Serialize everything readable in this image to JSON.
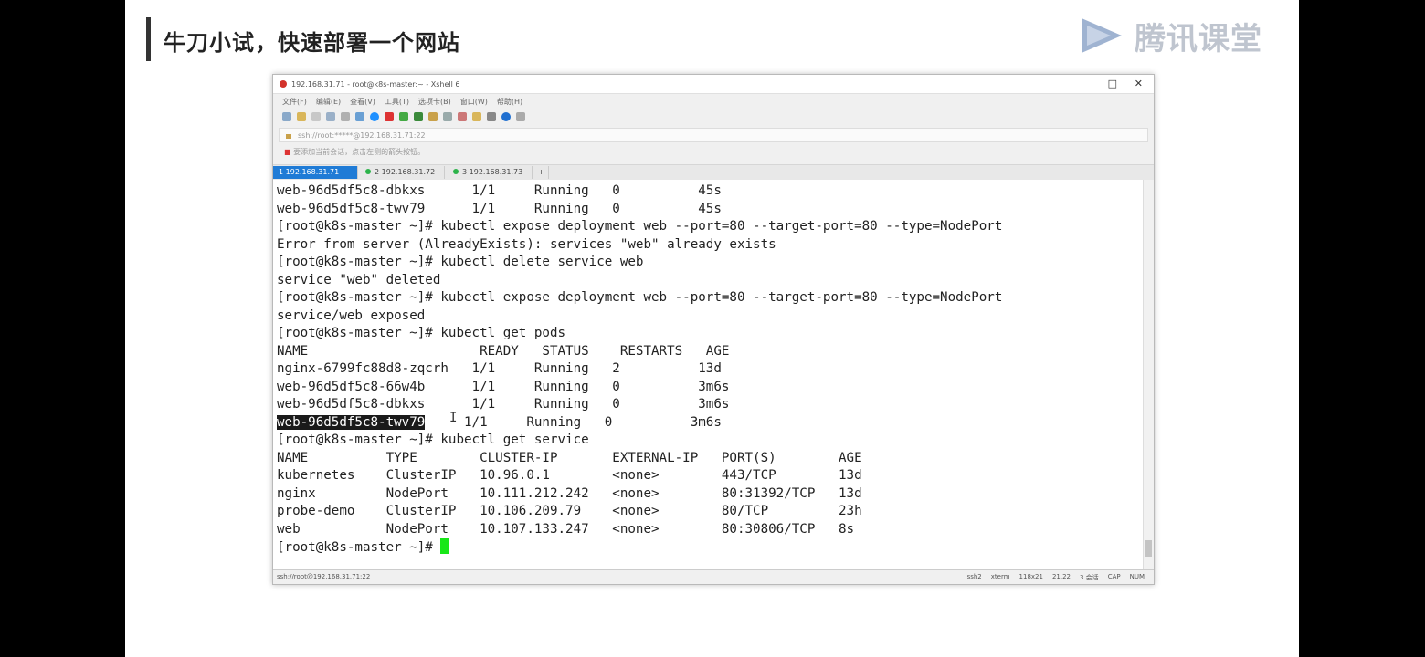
{
  "slide": {
    "title": "牛刀小试，快速部署一个网站",
    "logo_text": "腾讯课堂"
  },
  "window": {
    "title": "192.168.31.71 - root@k8s-master:~ - Xshell 6",
    "menu": [
      "文件(F)",
      "编辑(E)",
      "查看(V)",
      "工具(T)",
      "选项卡(B)",
      "窗口(W)",
      "帮助(H)"
    ],
    "address": "ssh://root:*****@192.168.31.71:22",
    "notice": "要添加当前会话，点击左侧的箭头按钮。",
    "tabs": [
      {
        "label": "1 192.168.31.71",
        "active": true
      },
      {
        "label": "2 192.168.31.72",
        "active": false
      },
      {
        "label": "3 192.168.31.73",
        "active": false
      }
    ],
    "add_tab": "+",
    "status_left": "ssh://root@192.168.31.71:22",
    "status_right": [
      "ssh2",
      "xterm",
      "118x21",
      "21,22",
      "3 会话",
      "CAP",
      "NUM"
    ]
  },
  "terminal": {
    "lines_before": [
      "web-96d5df5c8-dbkxs      1/1     Running   0          45s",
      "web-96d5df5c8-twv79      1/1     Running   0          45s",
      "[root@k8s-master ~]# kubectl expose deployment web --port=80 --target-port=80 --type=NodePort",
      "Error from server (AlreadyExists): services \"web\" already exists",
      "[root@k8s-master ~]# kubectl delete service web",
      "service \"web\" deleted",
      "[root@k8s-master ~]# kubectl expose deployment web --port=80 --target-port=80 --type=NodePort",
      "service/web exposed",
      "[root@k8s-master ~]# kubectl get pods",
      "NAME                      READY   STATUS    RESTARTS   AGE",
      "nginx-6799fc88d8-zqcrh   1/1     Running   2          13d",
      "web-96d5df5c8-66w4b      1/1     Running   0          3m6s",
      "web-96d5df5c8-dbkxs      1/1     Running   0          3m6s"
    ],
    "highlight_text": "web-96d5df5c8-twv79",
    "highlight_rest": "     1/1     Running   0          3m6s",
    "lines_after": [
      "[root@k8s-master ~]# kubectl get service",
      "NAME          TYPE        CLUSTER-IP       EXTERNAL-IP   PORT(S)        AGE",
      "kubernetes    ClusterIP   10.96.0.1        <none>        443/TCP        13d",
      "nginx         NodePort    10.111.212.242   <none>        80:31392/TCP   13d",
      "probe-demo    ClusterIP   10.106.209.79    <none>        80/TCP         23h",
      "web           NodePort    10.107.133.247   <none>        80:30806/TCP   8s"
    ],
    "prompt": "[root@k8s-master ~]# "
  }
}
